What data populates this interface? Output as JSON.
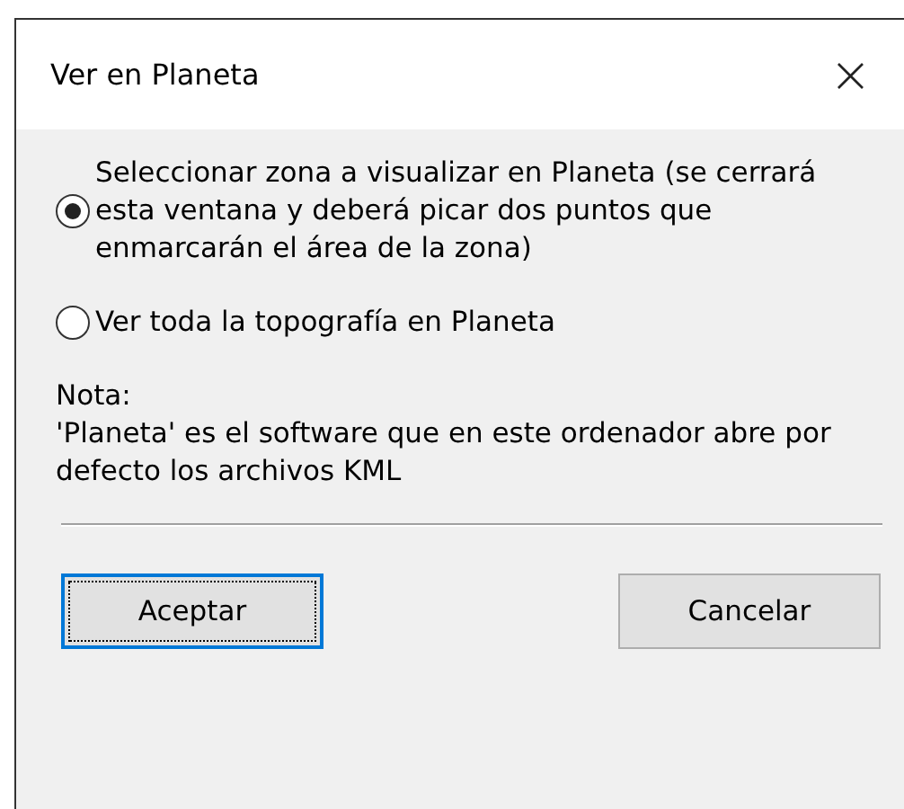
{
  "window": {
    "title": "Ver en Planeta",
    "close": "×"
  },
  "options": [
    {
      "label": "Seleccionar zona a visualizar en Planeta (se cerrará esta ventana y deberá picar dos puntos que enmarcarán el área de la zona)",
      "selected": true
    },
    {
      "label": "Ver toda la topografía en Planeta",
      "selected": false
    }
  ],
  "note": {
    "heading": "Nota:",
    "text": "'Planeta' es el software que en este ordenador abre por defecto los archivos KML"
  },
  "buttons": [
    {
      "label": "Aceptar",
      "focused": true
    },
    {
      "label": "Cancelar",
      "focused": false
    }
  ]
}
